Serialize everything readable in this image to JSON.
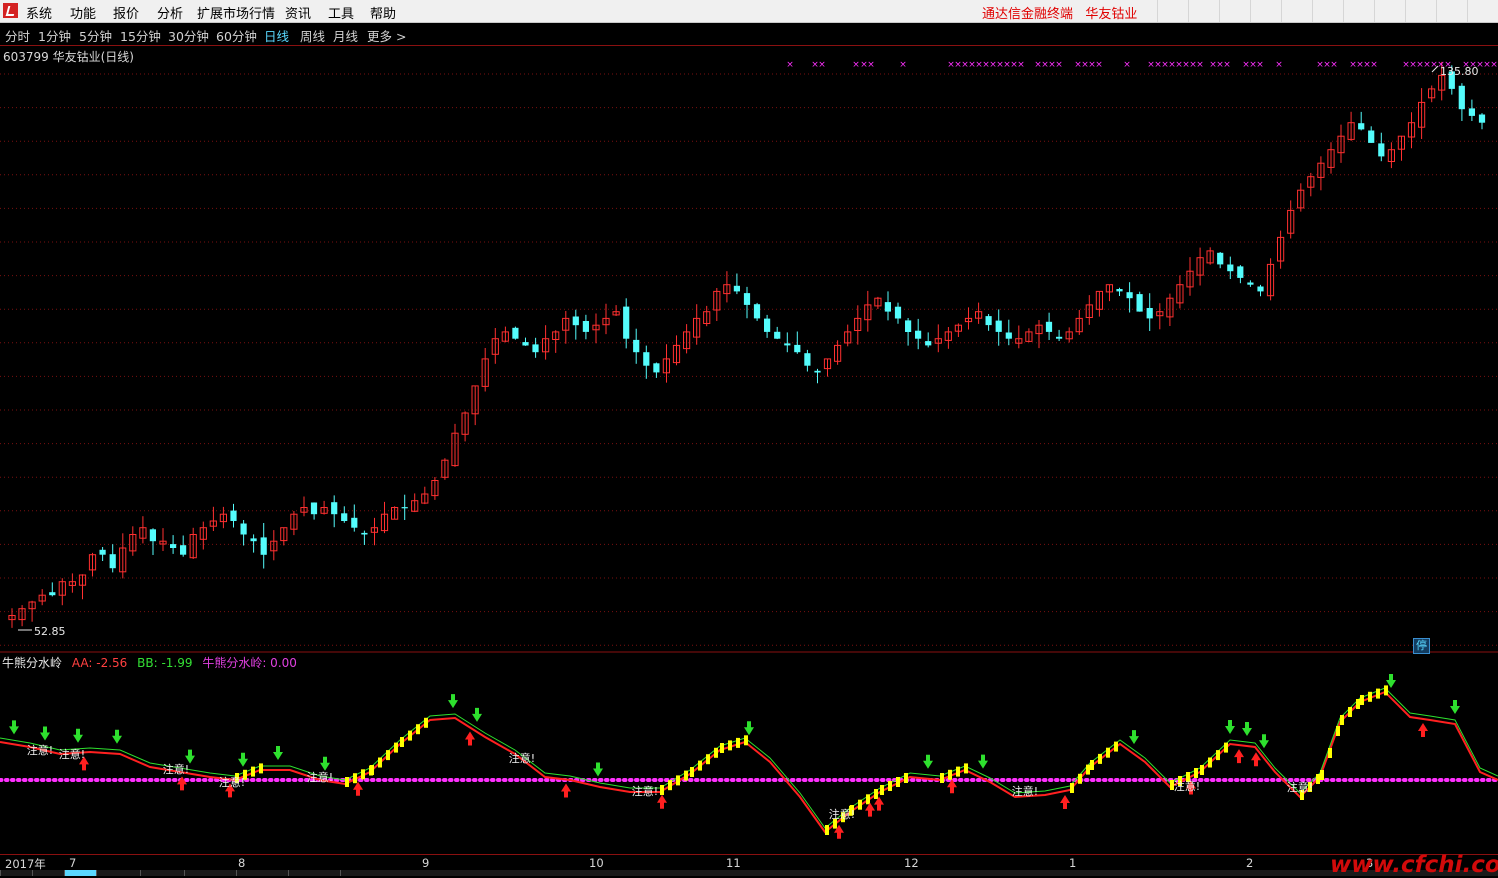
{
  "menu": {
    "items": [
      "系统",
      "功能",
      "报价",
      "分析",
      "扩展市场行情",
      "资讯",
      "工具",
      "帮助"
    ],
    "brand": "通达信金融终端",
    "stock_name": "华友钴业"
  },
  "periods": {
    "items": [
      "分时",
      "1分钟",
      "5分钟",
      "15分钟",
      "30分钟",
      "60分钟",
      "日线",
      "周线",
      "月线",
      "更多"
    ],
    "active_index": 6,
    "more_arrow": ">"
  },
  "chart": {
    "title": "603799 华友钴业(日线)",
    "high_label": "135.80",
    "low_label": "52.85",
    "stop_badge": "停"
  },
  "indicator": {
    "name": "牛熊分水岭",
    "aa": "AA: -2.56",
    "bb": "BB: -1.99",
    "ws": "牛熊分水岭: 0.00",
    "notice_text": "注意!"
  },
  "axis": {
    "months": [
      "2017年",
      "7",
      "8",
      "9",
      "10",
      "11",
      "12",
      "1",
      "2",
      "3"
    ]
  },
  "watermark": "www.cfchi.com",
  "colors": {
    "up": "#ff3030",
    "down": "#54fcfc",
    "grid": "#7a1010",
    "magenta": "#ff30ff",
    "yellow": "#ffff00",
    "green": "#2ee02e",
    "red_line": "#ff2020"
  },
  "chart_data": {
    "type": "candlestick",
    "title": "603799 华友钴业(日线)",
    "y_max_label": 135.8,
    "y_min_label": 52.85,
    "x_month_labels": [
      "2017年",
      "7",
      "8",
      "9",
      "10",
      "11",
      "12",
      "1",
      "2",
      "3"
    ],
    "closes_approx": [
      55,
      56,
      57,
      58,
      58,
      60,
      60,
      61,
      64,
      64,
      62,
      65,
      67,
      68,
      66,
      66,
      65,
      64,
      67,
      68,
      69,
      70,
      69,
      67,
      66,
      64,
      66,
      68,
      70,
      71,
      70,
      71,
      70,
      69,
      68,
      67,
      68,
      70,
      71,
      71,
      72,
      73,
      75,
      78,
      82,
      85,
      89,
      93,
      96,
      97,
      96,
      95,
      94,
      96,
      97,
      99,
      98,
      97,
      98,
      99,
      100,
      96,
      94,
      92,
      91,
      93,
      95,
      97,
      99,
      100,
      103,
      104,
      103,
      101,
      99,
      97,
      96,
      95,
      94,
      92,
      91,
      93,
      95,
      97,
      99,
      101,
      102,
      100,
      99,
      97,
      96,
      95,
      96,
      97,
      98,
      99,
      100,
      98,
      97,
      96,
      96,
      97,
      98,
      97,
      96,
      97,
      99,
      101,
      103,
      104,
      103,
      102,
      100,
      99,
      100,
      102,
      104,
      106,
      108,
      109,
      107,
      106,
      105,
      104,
      103,
      107,
      111,
      115,
      118,
      120,
      122,
      124,
      126,
      128,
      127,
      125,
      123,
      124,
      126,
      128,
      131,
      133,
      135,
      133,
      130,
      129,
      128
    ]
  }
}
